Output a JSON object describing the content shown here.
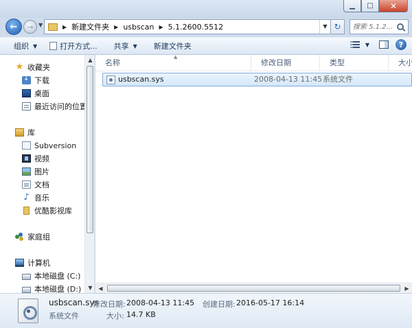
{
  "window": {
    "minimize_glyph": "▁",
    "maximize_glyph": "□",
    "close_glyph": "✕"
  },
  "address": {
    "breadcrumbs": [
      "新建文件夹",
      "usbscan",
      "5.1.2600.5512"
    ],
    "separator": "▶",
    "dropdown_glyph": "▼",
    "refresh_glyph": "↻"
  },
  "search": {
    "placeholder": "搜索 5.1.2..."
  },
  "toolbar": {
    "organize_label": "组织",
    "open_with_label": "打开方式...",
    "share_label": "共享",
    "new_folder_label": "新建文件夹",
    "dropdown_glyph": "▼",
    "help_glyph": "?"
  },
  "nav": {
    "favorites": {
      "label": "收藏夹",
      "items": [
        "下载",
        "桌面",
        "最近访问的位置"
      ]
    },
    "libraries": {
      "label": "库",
      "items": [
        "Subversion",
        "视频",
        "图片",
        "文档",
        "音乐",
        "优酷影视库"
      ]
    },
    "homegroup": {
      "label": "家庭组"
    },
    "computer": {
      "label": "计算机",
      "items": [
        "本地磁盘 (C:)",
        "本地磁盘 (D:)"
      ]
    },
    "scroll_up_glyph": "▲",
    "scroll_down_glyph": "▼"
  },
  "columns": {
    "name": "名称",
    "modified": "修改日期",
    "type": "类型",
    "size": "大小",
    "sort_glyph": "▲"
  },
  "files": [
    {
      "name": "usbscan.sys",
      "modified": "2008-04-13 11:45",
      "type": "系统文件"
    }
  ],
  "hscroll": {
    "left_glyph": "◀",
    "right_glyph": "▶"
  },
  "details": {
    "name": "usbscan.sys",
    "type": "系统文件",
    "modified_label": "修改日期:",
    "modified_value": "2008-04-13 11:45",
    "size_label": "大小:",
    "size_value": "14.7 KB",
    "created_label": "创建日期:",
    "created_value": "2016-05-17 16:14"
  }
}
